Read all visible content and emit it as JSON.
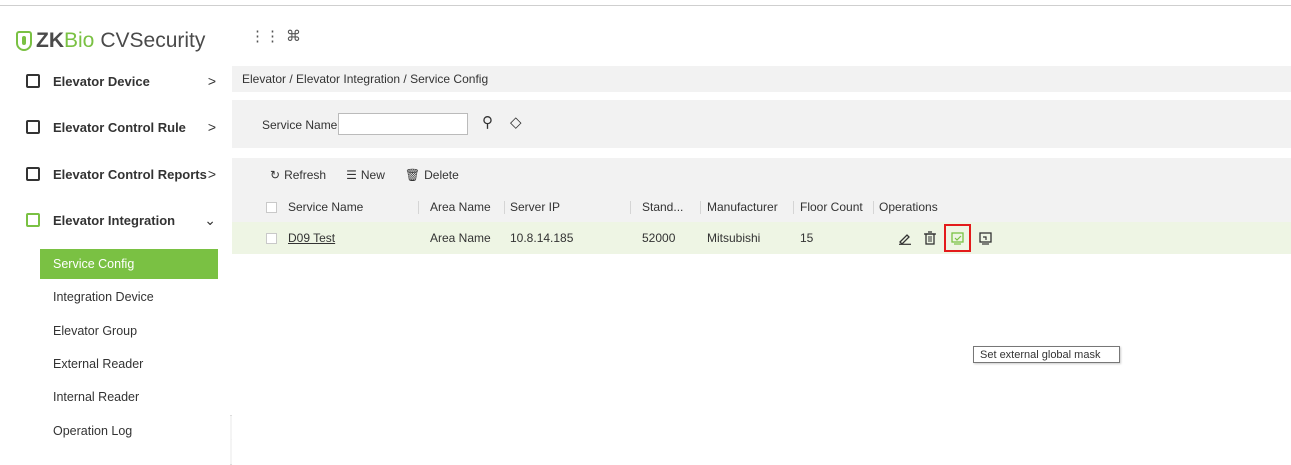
{
  "app": {
    "logo_prefix": "ZK",
    "logo_mid": "Bio",
    "logo_suffix": "CVSecurity",
    "topbar_icons": [
      "apps-grid-icon",
      "command-icon"
    ],
    "topbar_glyphs": [
      "⋮⋮",
      "⌘"
    ]
  },
  "sidebar": {
    "sections": [
      {
        "label": "Elevator Device",
        "chevron": ">",
        "icon": "device-icon"
      },
      {
        "label": "Elevator Control Rule",
        "chevron": ">",
        "icon": "rule-icon"
      },
      {
        "label": "Elevator Control Reports",
        "chevron": ">",
        "icon": "reports-icon"
      },
      {
        "label": "Elevator Integration",
        "chevron": "⌄",
        "icon": "integration-icon"
      }
    ],
    "subitems": [
      {
        "label": "Service Config",
        "active": true
      },
      {
        "label": "Integration Device"
      },
      {
        "label": "Elevator Group"
      },
      {
        "label": "External Reader"
      },
      {
        "label": "Internal Reader"
      },
      {
        "label": "Operation Log"
      }
    ],
    "collapse_glyph": "«"
  },
  "breadcrumb": "Elevator / Elevator Integration / Service Config",
  "search": {
    "label": "Service Name",
    "value": "",
    "search_glyph": "⚲",
    "clear_glyph": "◇"
  },
  "toolbar": {
    "refresh": "Refresh",
    "new": "New",
    "delete": "Delete"
  },
  "table": {
    "columns": [
      "Service Name",
      "Area Name",
      "Server IP",
      "Stand...",
      "Manufacturer",
      "Floor Count",
      "Operations"
    ],
    "rows": [
      {
        "service_name": "D09 Test",
        "area_name": "Area Name",
        "server_ip": "10.8.14.185",
        "stand": "52000",
        "manufacturer": "Mitsubishi",
        "floor_count": "15"
      }
    ]
  },
  "tooltip": "Set external global mask",
  "colors": {
    "brand": "#7ac143",
    "highlight": "#e31b1b",
    "row_selected": "#eef5e4"
  }
}
